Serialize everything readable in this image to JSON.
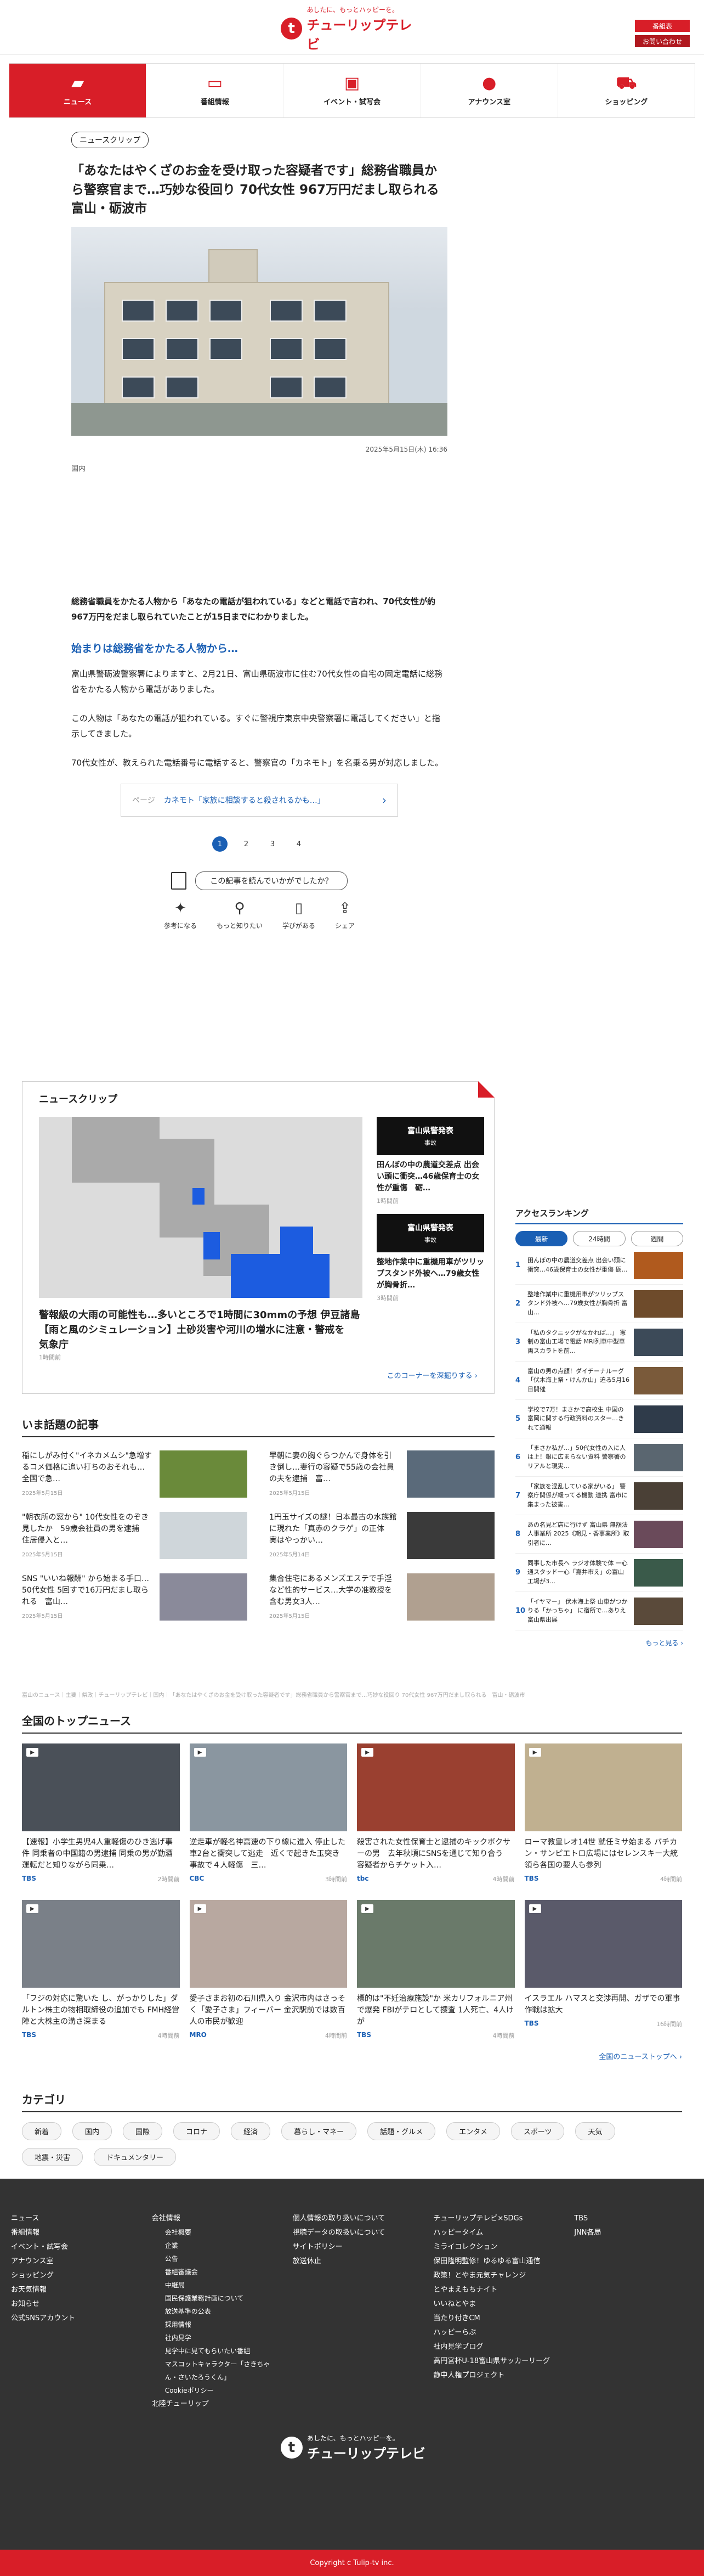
{
  "header": {
    "logo_tag": "あしたに、もっとハッピーを。",
    "logo_name": "チューリップテレビ",
    "btn1": "番組表",
    "btn2": "お問い合わせ"
  },
  "gnav": [
    {
      "label": "ニュース",
      "icon": "news-icon"
    },
    {
      "label": "番組情報",
      "icon": "tv-icon"
    },
    {
      "label": "イベント・試写会",
      "icon": "event-icon"
    },
    {
      "label": "アナウンス室",
      "icon": "microphone-icon"
    },
    {
      "label": "ショッピング",
      "icon": "cart-icon"
    }
  ],
  "article": {
    "category": "ニュースクリップ",
    "title": "「あなたはやくざのお金を受け取った容疑者です」総務省職員から警察官まで…巧妙な役回り 70代女性 967万円だまし取られる　富山・砺波市",
    "date": "2025年5月15日(木) 16:36",
    "genre": "国内",
    "lead": "総務省職員をかたる人物から「あなたの電話が狙われている」などと電話で言われ、70代女性が約967万円をだまし取られていたことが15日までにわかりました。",
    "h2": "始まりは総務省をかたる人物から…",
    "p1": "富山県警砺波警察署によりますと、2月21日、富山県砺波市に住む70代女性の自宅の固定電話に総務省をかたる人物から電話がありました。",
    "p2": "この人物は「あなたの電話が狙われている。すぐに警視庁東京中央警察署に電話してください」と指示してきました。",
    "p3": "70代女性が、教えられた電話番号に電話すると、警察官の「カネモト」を名乗る男が対応しました。",
    "next_label": "ページ",
    "next_text": "カネモト「家族に相談すると殺されるかも…」",
    "pages": [
      "1",
      "2",
      "3",
      "4"
    ],
    "react_q": "この記事を読んでいかがでしたか？",
    "reactions": [
      {
        "label": "参考になる",
        "icon": "lightbulb-icon"
      },
      {
        "label": "もっと知りたい",
        "icon": "search-icon"
      },
      {
        "label": "学びがある",
        "icon": "book-icon"
      },
      {
        "label": "シェア",
        "icon": "share-icon"
      }
    ]
  },
  "clip": {
    "title": "ニュースクリップ",
    "caption": "警報級の大雨の可能性も…多いところで1時間に30mmの予想 伊豆諸島【雨と風のシミュレーション】土砂災害や河川の増水に注意・警戒を　気象庁",
    "date": "1時間前",
    "side": [
      {
        "thumb": "富山県警発表",
        "thumb_sub": "事故",
        "title": "田んぼの中の農道交差点 出会い頭に衝突…46歳保育士の女性が重傷　砺…",
        "date": "1時間前"
      },
      {
        "thumb": "富山県警発表",
        "thumb_sub": "事故",
        "title": "整地作業中に重機用車がツリップスタンド外被ヘ…79歳女性が胸骨折…",
        "date": "3時間前"
      }
    ],
    "more": "このコーナーを深掘りする ›"
  },
  "ranking": {
    "title": "アクセスランキング",
    "tabs": [
      "最新",
      "24時間",
      "週間"
    ],
    "items": [
      {
        "n": "1",
        "t": "田んぼの中の農道交差点 出会い頭に衝突…46歳保育士の女性が重傷 砺…"
      },
      {
        "n": "2",
        "t": "整地作業中に重機用車がツリップスタンド外被ヘ…79歳女性が胸骨折 富山…"
      },
      {
        "n": "3",
        "t": "「私のタクニックがなかれば…」 憲制の富山工場で電話 MRI列車中型車両スカラトを前…"
      },
      {
        "n": "4",
        "t": "富山の男の点額！ダイチーナルーグ「伏木海上祭・けんか山」迫る5月16日開催"
      },
      {
        "n": "5",
        "t": "学校で7万！まさかで高校生 中国の富岡に関する行政資料のスター…きれて通報"
      },
      {
        "n": "6",
        "t": "「まさか私が…」50代女性の入に人は上！銀に広まらない資料 警察署のリアルと現実…"
      },
      {
        "n": "7",
        "t": "「家族を混乱している家がいる」 警察庁関係が緩ってる機動 連携 富市に集まった被害…"
      },
      {
        "n": "8",
        "t": "あの名見ど店に行けず 富山県 無額法人事業所 2025《期見・香事業所》取引者に…"
      },
      {
        "n": "9",
        "t": "同事した市長ヘ ラジオ体験で体 一心通スタッド一心「嘉井市え」の富山工場が3…"
      },
      {
        "n": "10",
        "t": "「イヤマー」 伏木海上祭 山車がつかりる「かっちゃ」 に宿所で…ありえ富山県出展"
      }
    ],
    "more": "もっと見る ›"
  },
  "topics": {
    "title": "いま話題の記事",
    "items": [
      {
        "t": "稲にしがみ付く\"イネカメムシ\"急増するコメ価格に追い打ちのおそれも…全国で急…",
        "d": "2025年5月15日"
      },
      {
        "t": "早朝に妻の胸ぐらつかんで身体を引き倒し…妻行の容疑で55歳の会社員の夫を逮捕　富…",
        "d": "2025年5月15日"
      },
      {
        "t": "\"朝衣所の窓から\" 10代女性をのぞき見したか　59歳会社員の男を逮捕　住居侵入と…",
        "d": "2025年5月15日"
      },
      {
        "t": "1円玉サイズの謎！日本最古の水族館に現れた「真赤のクラゲ」の正体　実はやっかい…",
        "d": "2025年5月14日"
      },
      {
        "t": "SNS \"いいね報酬\" から始まる手口…50代女性 5回すで16万円だまし取られる　富山…",
        "d": "2025年5月15日"
      },
      {
        "t": "集合住宅にあるメンズエステで手淫など性的サービス…大学の准教授を含む男女3人…",
        "d": "2025年5月15日"
      }
    ]
  },
  "breadcrumb": "富山のニュース｜主要｜県政｜チューリップテレビ｜国内｜「あなたはやくざのお金を受け取った容疑者です」総務省職員から警察官まで…巧妙な役回り 70代女性 967万円だまし取られる　富山・砺波市",
  "national": {
    "title": "全国のトップニュース",
    "items": [
      {
        "t": "【速報】小学生男児4人重軽傷のひき逃げ事件 同乗者の中国籍の男逮捕 同乗の男が勤酒運転だと知りながら同乗…",
        "s": "TBS",
        "time": "2時間前"
      },
      {
        "t": "逆走車が軽名神高速の下り線に進入 停止した車2台と衝突して逃走　近くで起きた玉突き事故で４人軽傷　三…",
        "s": "CBC",
        "time": "3時間前"
      },
      {
        "t": "殺害された女性保育士と逮捕のキックボクサーの男　去年秋頃にSNSを通じて知り合う　容疑者からチケット入…",
        "s": "tbc",
        "time": "4時間前"
      },
      {
        "t": "ローマ教皇レオ14世 就任ミサ始まる バチカン・サンピエトロ広場にはセレンスキー大統領ら各国の要人も参列",
        "s": "TBS",
        "time": "4時間前"
      },
      {
        "t": "「フジの対応に驚いた し、がっかりした」ダルトン株主の物相取締役の追加でも FMH経営陣と大株主の溝さ深まる",
        "s": "TBS",
        "time": "4時間前"
      },
      {
        "t": "愛子さまお初の石川県入り 金沢市内はさっそく「愛子さま」フィーバー 金沢駅前では数百人の市民が歓迎",
        "s": "MRO",
        "time": "4時間前"
      },
      {
        "t": "標的は\"不妊治療施設\"か 米カリフォルニア州で爆発 FBIがテロとして捜査 1人死亡、4人けが",
        "s": "TBS",
        "time": "4時間前"
      },
      {
        "t": "イスラエル ハマスと交渉再開、ガザでの軍事作戦は拡大",
        "s": "TBS",
        "time": "16時間前"
      }
    ],
    "more": "全国のニューストップへ ›"
  },
  "categories": {
    "title": "カテゴリ",
    "items": [
      "新着",
      "国内",
      "国際",
      "コロナ",
      "経済",
      "暮らし・マネー",
      "話題・グルメ",
      "エンタメ",
      "スポーツ",
      "天気",
      "地震・災害",
      "ドキュメンタリー"
    ]
  },
  "footer": {
    "col1": [
      "ニュース",
      "番組情報",
      "イベント・試写会",
      "アナウンス室",
      "ショッピング",
      "お天気情報",
      "お知らせ",
      "公式SNSアカウント"
    ],
    "col2_head": "会社情報",
    "col2": [
      "会社概要",
      "企業",
      "公告",
      "番組審議会",
      "中継局",
      "国民保護業務計画について",
      "放送基準の公表",
      "採用情報",
      "社内見学",
      "見学中に見てもらいたい番組",
      "マスコットキャラクター「さきちゃん・さいたろうくん」",
      "Cookieポリシー"
    ],
    "col2_tail": "北陸チューリップ",
    "col3": [
      "個人情報の取り扱いについて",
      "視聴データの取扱いについて",
      "サイトポリシー",
      "放送休止"
    ],
    "col4": [
      "チューリップテレビ×SDGs",
      "ハッピータイム",
      "ミライコレクション",
      "保田隆明監修！ゆるゆる富山通信",
      "政策！とやま元気チャレンジ",
      "とやまえもちナイト",
      "いいねとやま",
      "当たり付きCM",
      "ハッピーらぶ",
      "社内見学ブログ",
      "高円宮杯U-18富山県サッカーリーグ",
      "静中人権プロジェクト"
    ],
    "col5": [
      "TBS",
      "JNN各局"
    ],
    "copyright": "Copyright c Tulip-tv inc."
  }
}
